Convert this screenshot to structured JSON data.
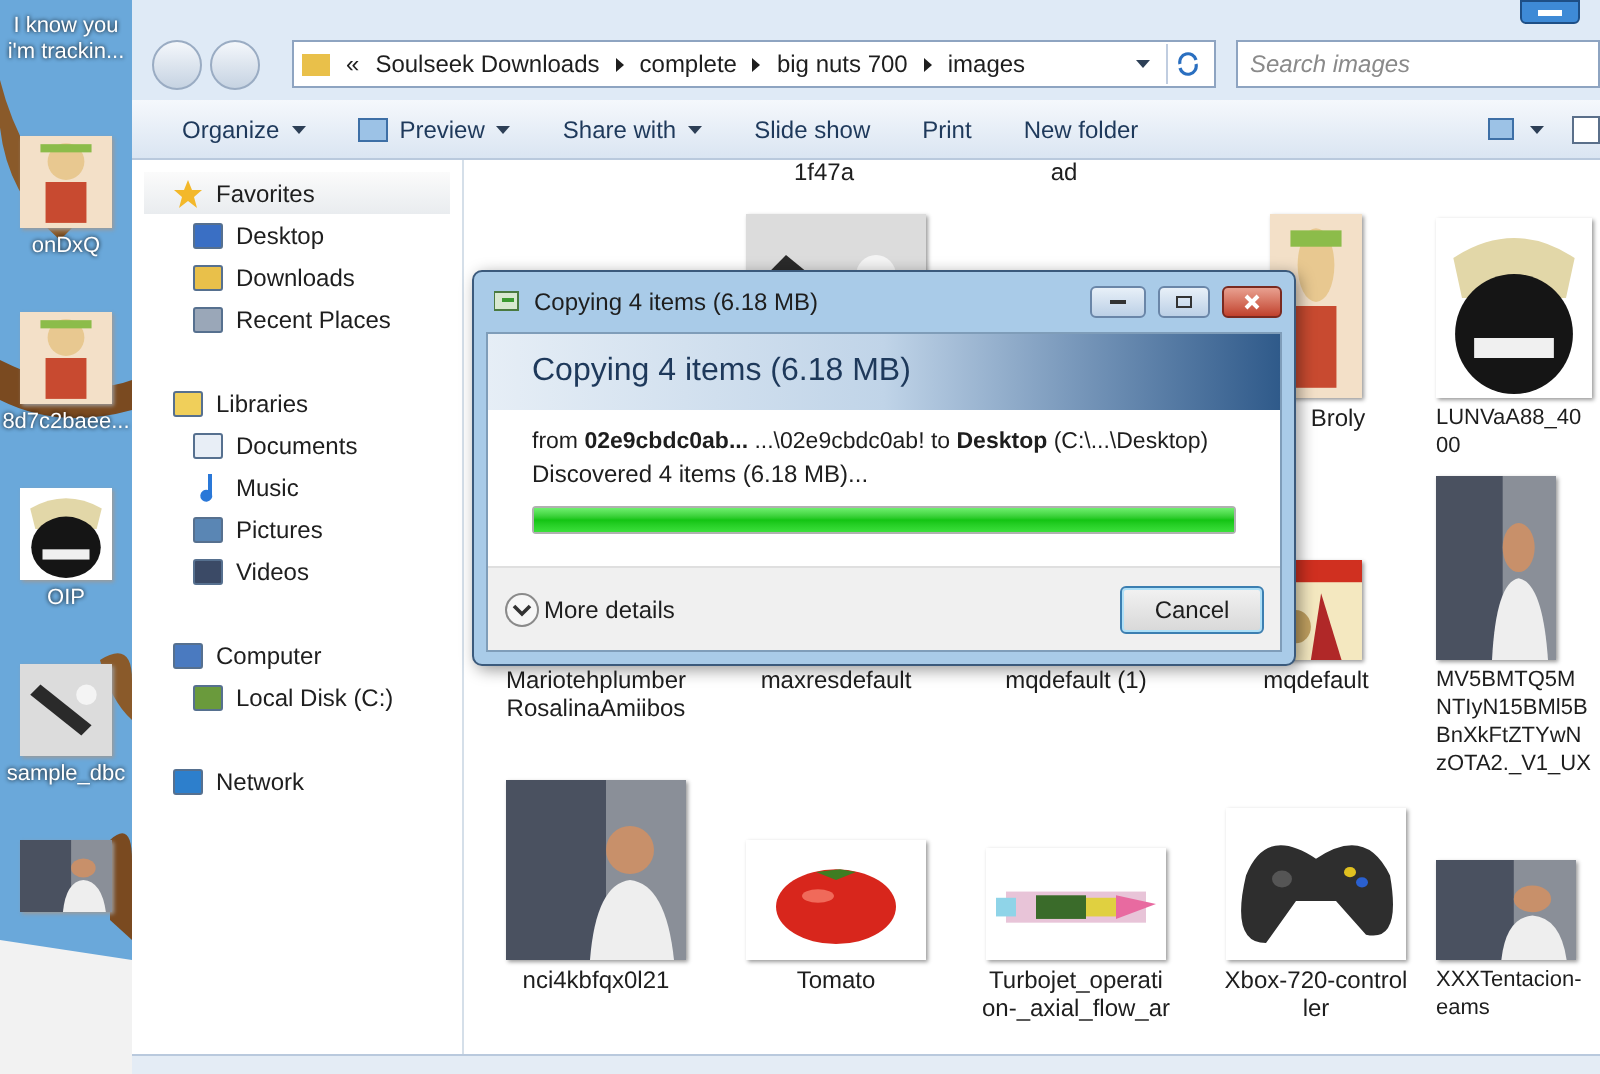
{
  "desktop": {
    "items": [
      {
        "label": "I know you i'm trackin..."
      },
      {
        "label": "onDxQ"
      },
      {
        "label": "8d7c2baee..."
      },
      {
        "label": "OIP"
      },
      {
        "label": "sample_dbc"
      },
      {
        "kind": "video"
      }
    ]
  },
  "address_bar": {
    "overflow": "«",
    "crumbs": [
      "Soulseek Downloads",
      "complete",
      "big nuts 700",
      "images"
    ]
  },
  "search": {
    "placeholder": "Search images"
  },
  "toolbar": {
    "buttons": [
      {
        "label": "Organize",
        "menu": true
      },
      {
        "label": "Preview",
        "menu": true
      },
      {
        "label": "Share with",
        "menu": true
      },
      {
        "label": "Slide show",
        "menu": false
      },
      {
        "label": "Print",
        "menu": false
      },
      {
        "label": "New folder",
        "menu": false
      }
    ]
  },
  "sidebar": {
    "groups": [
      {
        "label": "Favorites",
        "children": [
          {
            "label": "Desktop"
          },
          {
            "label": "Downloads"
          },
          {
            "label": "Recent Places"
          }
        ]
      },
      {
        "label": "Libraries",
        "children": [
          {
            "label": "Documents"
          },
          {
            "label": "Music"
          },
          {
            "label": "Pictures"
          },
          {
            "label": "Videos"
          }
        ]
      },
      {
        "label": "Computer",
        "children": [
          {
            "label": "Local Disk (C:)"
          }
        ]
      },
      {
        "label": "Network"
      }
    ]
  },
  "files": {
    "top_labels": [
      "1f47a",
      "ad"
    ],
    "rows": [
      [
        {
          "kind": "covered"
        },
        {
          "kind": "covered"
        },
        {
          "kind": "covered"
        },
        {
          "kind": "file",
          "label": "Broly"
        },
        {
          "kind": "file",
          "label": "LUNVaA88_40\n00"
        }
      ],
      [
        {
          "kind": "file",
          "label": "Mariotehplumber\nRosalinaAmiibos"
        },
        {
          "kind": "file",
          "label": "maxresdefault"
        },
        {
          "kind": "file",
          "label": "mqdefault (1)"
        },
        {
          "kind": "file",
          "label": "mqdefault"
        },
        {
          "kind": "file",
          "label": "MV5BMTQ5M\nNTIyN15BMl5B\nBnXkFtZTYwN\nzOTA2._V1_UX"
        }
      ],
      [
        {
          "kind": "file",
          "label": "nci4kbfqx0l21"
        },
        {
          "kind": "file",
          "label": "Tomato"
        },
        {
          "kind": "file",
          "label": "Turbojet_operati\non-_axial_flow_ar"
        },
        {
          "kind": "file",
          "label": "Xbox-720-control\nler"
        },
        {
          "kind": "file",
          "label": "XXXTentacion-\neams"
        }
      ]
    ]
  },
  "dialog": {
    "title": "Copying 4 items (6.18 MB)",
    "heading": "Copying 4 items (6.18 MB)",
    "from_line": "from **02e9cbdc0ab...** ...\\02e9cbdc0ab! to **Desktop** (C:\\...\\Desktop)",
    "status": "Discovered 4 items (6.18 MB)...",
    "progress": {
      "level": 1
    },
    "more_details": "More details",
    "cancel": "Cancel"
  }
}
